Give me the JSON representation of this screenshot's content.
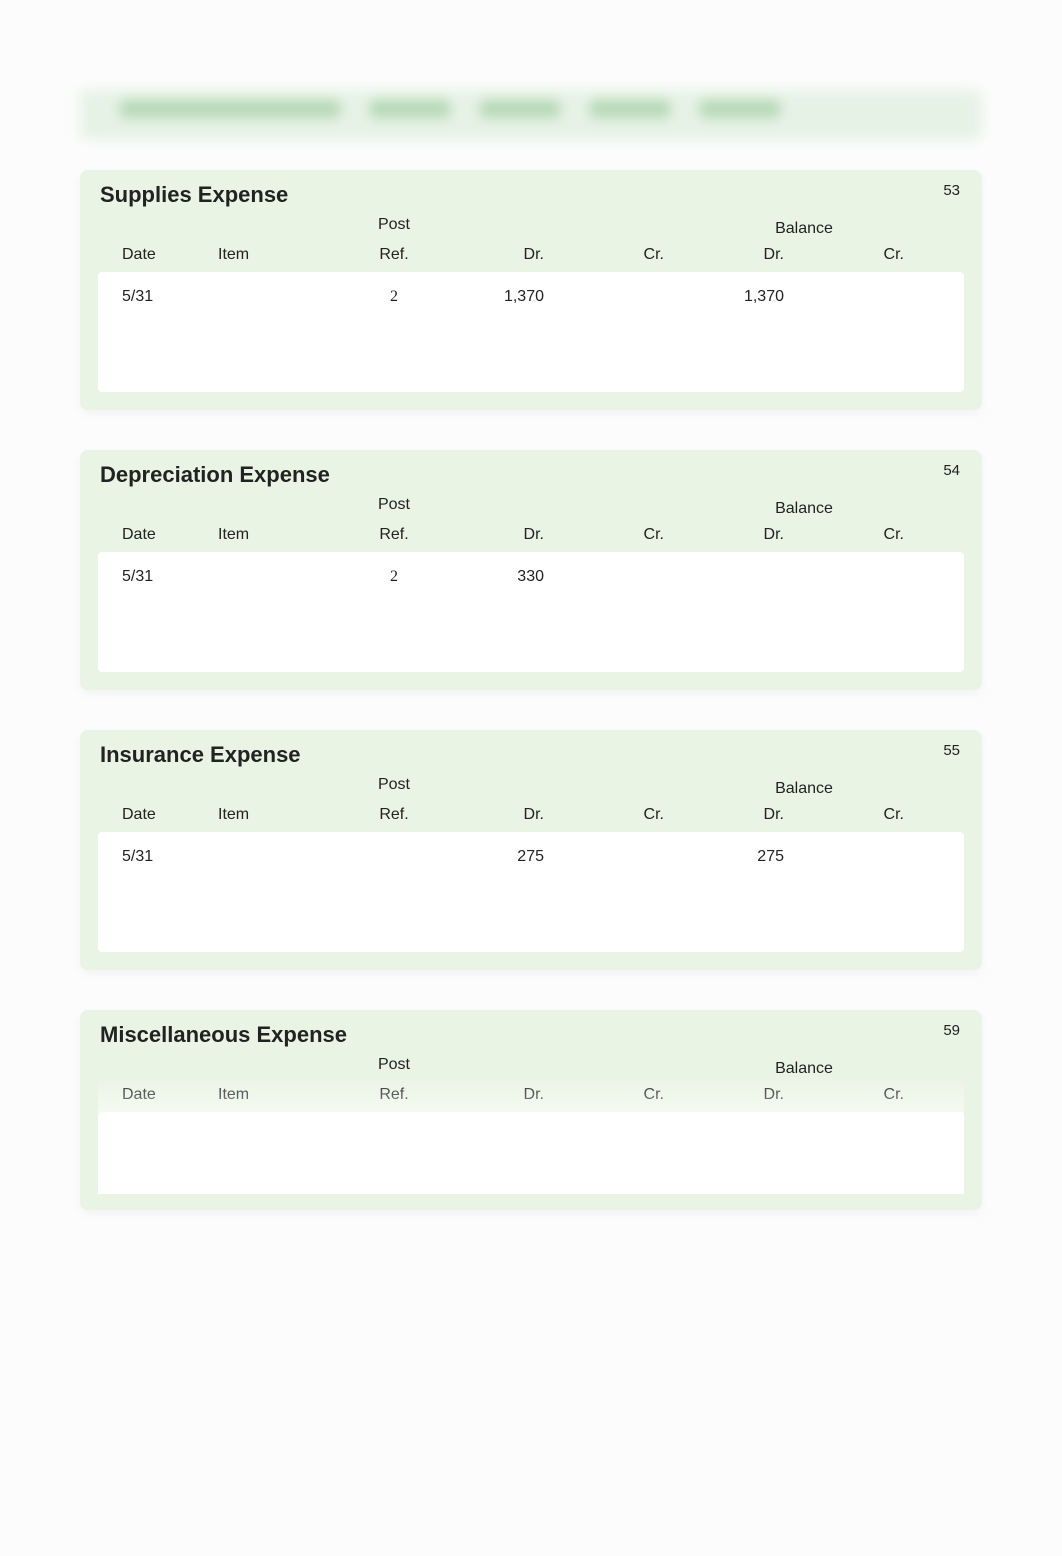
{
  "columns": {
    "date": "Date",
    "item": "Item",
    "postref_top": "Post",
    "postref": "Ref.",
    "dr": "Dr.",
    "cr": "Cr.",
    "balance": "Balance",
    "balance_dr": "Dr.",
    "balance_cr": "Cr."
  },
  "ledgers": [
    {
      "title": "Supplies Expense",
      "acct_no": "53",
      "rows": [
        {
          "date": "5/31",
          "item": "",
          "postref": "2",
          "dr": "1,370",
          "cr": "",
          "bal_dr": "1,370",
          "bal_cr": ""
        },
        {
          "date": "",
          "item": "",
          "postref": "",
          "dr": "",
          "cr": "",
          "bal_dr": "",
          "bal_cr": ""
        }
      ]
    },
    {
      "title": "Depreciation Expense",
      "acct_no": "54",
      "rows": [
        {
          "date": "5/31",
          "item": "",
          "postref": "2",
          "dr": "330",
          "cr": "",
          "bal_dr": "",
          "bal_cr": ""
        },
        {
          "date": "",
          "item": "",
          "postref": "",
          "dr": "",
          "cr": "",
          "bal_dr": "",
          "bal_cr": ""
        }
      ]
    },
    {
      "title": "Insurance Expense",
      "acct_no": "55",
      "rows": [
        {
          "date": "5/31",
          "item": "",
          "postref": "",
          "dr": "275",
          "cr": "",
          "bal_dr": "275",
          "bal_cr": ""
        },
        {
          "date": "",
          "item": "",
          "postref": "",
          "dr": "",
          "cr": "",
          "bal_dr": "",
          "bal_cr": ""
        }
      ]
    },
    {
      "title": "Miscellaneous Expense",
      "acct_no": "59",
      "rows": [
        {
          "date": "",
          "item": "",
          "postref": "",
          "dr": "",
          "cr": "",
          "bal_dr": "",
          "bal_cr": ""
        },
        {
          "date": "",
          "item": "",
          "postref": "",
          "dr": "",
          "cr": "",
          "bal_dr": "",
          "bal_cr": ""
        }
      ],
      "blurred": true
    }
  ]
}
